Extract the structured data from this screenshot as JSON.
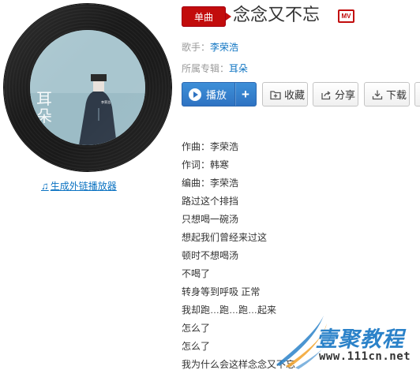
{
  "song": {
    "type_badge": "单曲",
    "title": "念念又不忘",
    "mv_label": "MV",
    "artist_label": "歌手：",
    "artist": "李荣浩",
    "album_label": "所属专辑：",
    "album": "耳朵"
  },
  "cover": {
    "album_text": "耳朵"
  },
  "actions": {
    "play": "播放",
    "add": "+",
    "favorite": "收藏",
    "share": "分享",
    "download": "下载"
  },
  "outer_player_link": "生成外链播放器",
  "lyrics": [
    "作曲：李荣浩",
    "作词：韩寒",
    "编曲：李荣浩",
    "路过这个排挡",
    "只想喝一碗汤",
    "想起我们曾经来过这",
    "顿时不想喝汤",
    "不喝了",
    "转身等到呼吸 正常",
    "我却跑…跑…跑…起来",
    "怎么了",
    "怎么了",
    "我为什么会这样念念又不忘"
  ],
  "watermark": {
    "brand": "壹聚教程",
    "url": "www.111cn.net"
  },
  "colors": {
    "accent_red": "#c20c0c",
    "link_blue": "#0c73c2",
    "play_blue": "#2e73c2"
  }
}
